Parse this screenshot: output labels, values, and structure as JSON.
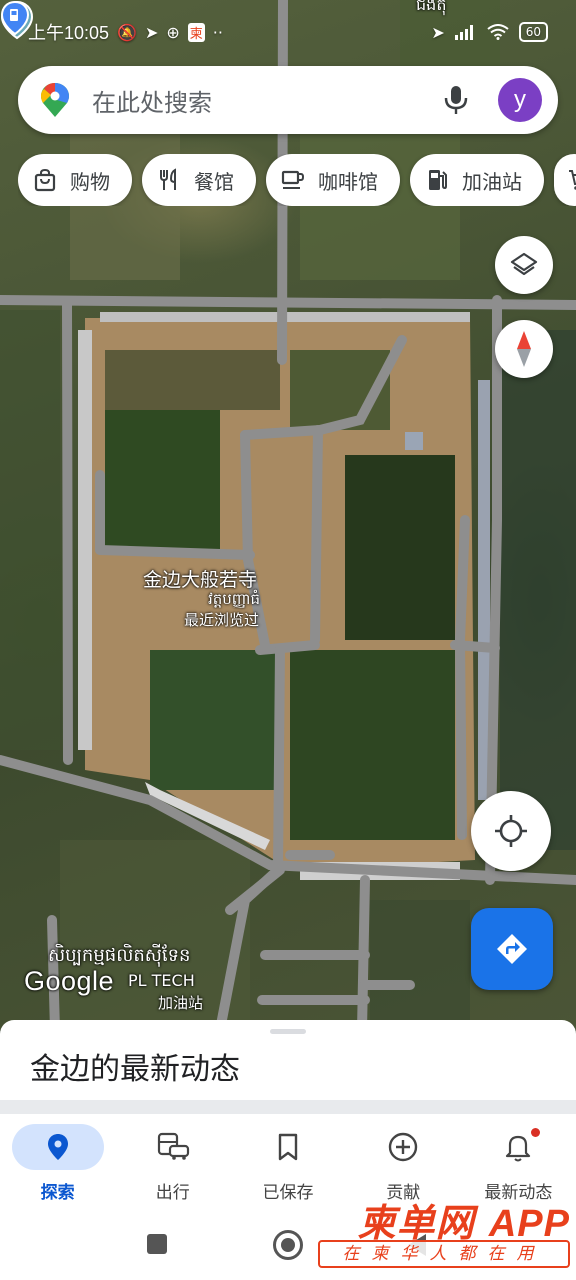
{
  "status_bar": {
    "time": "上午10:05",
    "left_icons": [
      "mute-icon",
      "location-arrow-icon",
      "app-icon",
      "dongche-app-icon",
      "more-dots-icon"
    ],
    "battery": "60"
  },
  "search": {
    "placeholder": "在此处搜索",
    "avatar_letter": "y"
  },
  "chips": [
    {
      "label": "购物",
      "icon": "shopping-bag-icon"
    },
    {
      "label": "餐馆",
      "icon": "restaurant-icon"
    },
    {
      "label": "咖啡馆",
      "icon": "coffee-icon"
    },
    {
      "label": "加油站",
      "icon": "gas-station-icon"
    },
    {
      "label": "",
      "icon": "cart-icon"
    }
  ],
  "map": {
    "temple": {
      "name": "金边大般若寺",
      "khmer": "វត្តបញ្ញាធំ",
      "recent": "最近浏览过"
    },
    "gas_station": {
      "name_line1": "សិប្បកម្មផលិតស៊ីទែន",
      "name_line2": "PL TECH",
      "type": "加油站"
    },
    "attribution": "Google",
    "top_edge_label": "ជំងឺតុ"
  },
  "sheet": {
    "title": "金边的最新动态"
  },
  "nav": [
    {
      "label": "探索",
      "icon": "explore-pin-icon",
      "active": true
    },
    {
      "label": "出行",
      "icon": "commute-icon",
      "active": false
    },
    {
      "label": "已保存",
      "icon": "bookmark-icon",
      "active": false
    },
    {
      "label": "贡献",
      "icon": "add-circle-icon",
      "active": false
    },
    {
      "label": "最新动态",
      "icon": "bell-icon",
      "active": false
    }
  ],
  "watermark": {
    "brand": "柬单网",
    "app": "APP",
    "slogan": "在柬华人都在用"
  },
  "colors": {
    "accent": "#1a73e8",
    "avatar": "#7b3fc4",
    "active_pill": "#d3e3fd",
    "watermark": "#e8401c"
  }
}
